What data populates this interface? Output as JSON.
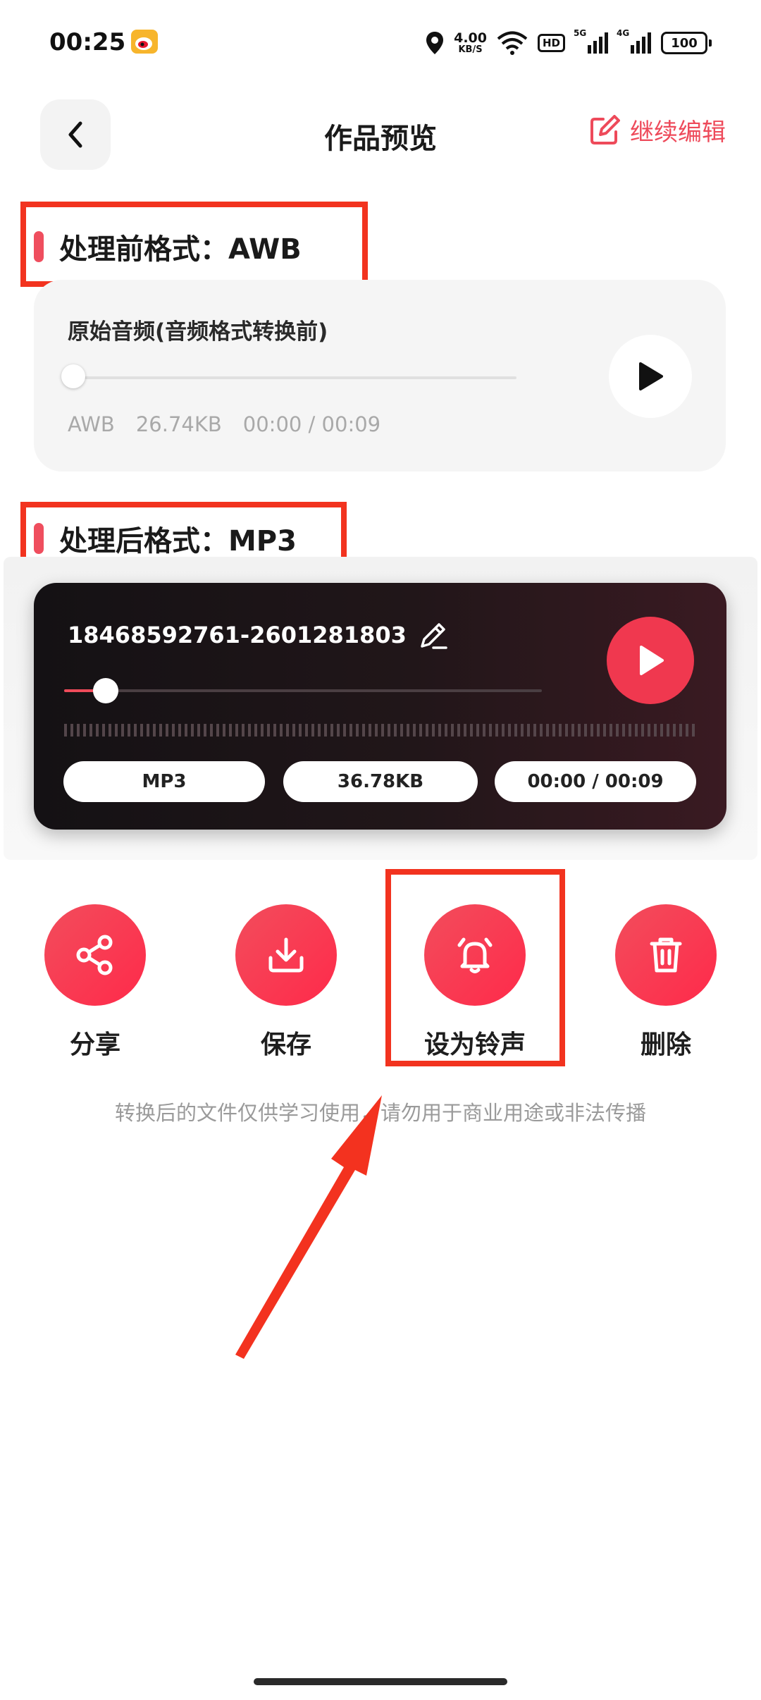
{
  "status_bar": {
    "time": "00:25",
    "net_speed_value": "4.00",
    "net_speed_unit": "KB/S",
    "hd_label": "HD",
    "signal1_label": "5G",
    "signal2_label": "4G",
    "battery": "100"
  },
  "header": {
    "title": "作品预览",
    "edit_label": "继续编辑",
    "accent_color": "#ee4a5a"
  },
  "before": {
    "section_label": "处理前格式：AWB",
    "card_title": "原始音频(音频格式转换前)",
    "format": "AWB",
    "size": "26.74KB",
    "time": "00:00 / 00:09"
  },
  "after": {
    "section_label": "处理后格式：MP3",
    "file_name": "18468592761-2601281803",
    "format": "MP3",
    "size": "36.78KB",
    "time": "00:00 / 00:09",
    "progress": 0.06
  },
  "actions": [
    {
      "label": "分享",
      "icon": "share-icon"
    },
    {
      "label": "保存",
      "icon": "download-icon"
    },
    {
      "label": "设为铃声",
      "icon": "bell-icon"
    },
    {
      "label": "删除",
      "icon": "trash-icon"
    }
  ],
  "disclaimer": "转换后的文件仅供学习使用，请勿用于商业用途或非法传播"
}
